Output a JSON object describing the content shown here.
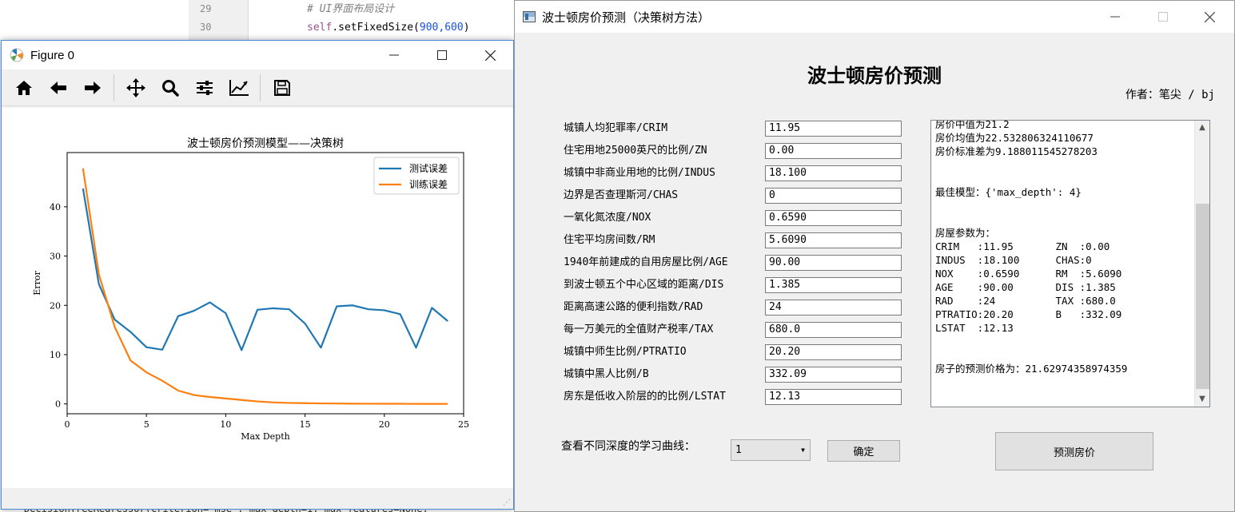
{
  "editor": {
    "line_numbers": [
      "29",
      "30"
    ],
    "line29": "# UI界面布局设计",
    "line30_self": "self",
    "line30_call": ".setFixedSize(",
    "line30_args": "900,600",
    "line30_end": ")",
    "bottom_code": "DecisionTreeRegressor(criterion='mse', max_depth=1, max_features=None,"
  },
  "figure": {
    "window_title": "Figure 0",
    "toolbar": [
      "home-icon",
      "back-icon",
      "forward-icon",
      "pan-icon",
      "zoom-icon",
      "subplots-icon",
      "axes-icon",
      "save-icon"
    ]
  },
  "chart_data": {
    "type": "line",
    "title": "波士顿房价预测模型——决策树",
    "xlabel": "Max Depth",
    "ylabel": "Error",
    "xlim": [
      0,
      25
    ],
    "ylim": [
      -2,
      51
    ],
    "xticks": [
      0,
      5,
      10,
      15,
      20,
      25
    ],
    "yticks": [
      0,
      10,
      20,
      30,
      40
    ],
    "legend_position": "top-right",
    "grid": false,
    "x": [
      1,
      2,
      3,
      4,
      5,
      6,
      7,
      8,
      9,
      10,
      11,
      12,
      13,
      14,
      15,
      16,
      17,
      18,
      19,
      20,
      21,
      22,
      23,
      24
    ],
    "series": [
      {
        "name": "测试误差",
        "color": "#1f77b4",
        "values": [
          43.7,
          24.3,
          17.1,
          14.6,
          11.5,
          11.0,
          17.8,
          18.9,
          20.6,
          18.4,
          10.9,
          19.1,
          19.4,
          19.2,
          16.3,
          11.4,
          19.8,
          20.0,
          19.2,
          19.0,
          18.2,
          11.4,
          19.5,
          16.8
        ]
      },
      {
        "name": "训练误差",
        "color": "#ff7f0e",
        "values": [
          47.8,
          26.3,
          15.6,
          8.8,
          6.4,
          4.7,
          2.7,
          1.8,
          1.4,
          1.1,
          0.8,
          0.5,
          0.3,
          0.2,
          0.15,
          0.1,
          0.08,
          0.05,
          0.04,
          0.03,
          0.02,
          0.01,
          0.01,
          0.0
        ]
      }
    ]
  },
  "app": {
    "window_title": "波士顿房价预测（决策树方法）",
    "heading": "波士顿房价预测",
    "author": "作者：笔尖 / bj",
    "fields": [
      {
        "label": "城镇人均犯罪率/CRIM",
        "value": "11.95"
      },
      {
        "label": "住宅用地25000英尺的比例/ZN",
        "value": "0.00"
      },
      {
        "label": "城镇中非商业用地的比例/INDUS",
        "value": "18.100"
      },
      {
        "label": "边界是否查理斯河/CHAS",
        "value": "0"
      },
      {
        "label": "一氧化氮浓度/NOX",
        "value": "0.6590"
      },
      {
        "label": "住宅平均房间数/RM",
        "value": "5.6090"
      },
      {
        "label": "1940年前建成的自用房屋比例/AGE",
        "value": "90.00"
      },
      {
        "label": "到波士顿五个中心区域的距离/DIS",
        "value": "1.385"
      },
      {
        "label": "距离高速公路的便利指数/RAD",
        "value": "24"
      },
      {
        "label": "每一万美元的全值财产税率/TAX",
        "value": "680.0"
      },
      {
        "label": "城镇中师生比例/PTRATIO",
        "value": "20.20"
      },
      {
        "label": "城镇中黑人比例/B",
        "value": "332.09"
      },
      {
        "label": "房东是低收入阶层的的比例/LSTAT",
        "value": "12.13"
      }
    ],
    "output": "房价中值为21.2\n房价均值为22.532806324110677\n房价标准差为9.188011545278203\n\n\n最佳模型：{'max_depth': 4}\n\n\n房屋参数为：\nCRIM   :11.95       ZN  :0.00\nINDUS  :18.100      CHAS:0\nNOX    :0.6590      RM  :5.6090\nAGE    :90.00       DIS :1.385\nRAD    :24          TAX :680.0\nPTRATIO:20.20       B   :332.09\nLSTAT  :12.13\n\n\n房子的预测价格为：21.62974358974359",
    "curve_label": "查看不同深度的学习曲线：",
    "depth_select": "1",
    "confirm_button": "确定",
    "predict_button": "预测房价"
  }
}
